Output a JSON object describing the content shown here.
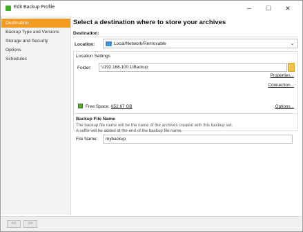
{
  "window": {
    "title": "Edit Backup Profile",
    "minimize": "─",
    "maximize": "☐",
    "close": "✕"
  },
  "sidebar": {
    "items": [
      {
        "label": "Destination",
        "active": true
      },
      {
        "label": "Backup Type and Versions",
        "active": false
      },
      {
        "label": "Storage and Security",
        "active": false
      },
      {
        "label": "Options",
        "active": false
      },
      {
        "label": "Schedules",
        "active": false
      }
    ]
  },
  "main": {
    "heading": "Select a destination where to store your archives",
    "destination_label": "Destination:",
    "location_label": "Location:",
    "location_value": "Local/Network/Removable",
    "location_settings_title": "Location Settings",
    "folder_label": "Folder:",
    "folder_value": "\\\\192.168.100.1\\Backup",
    "properties_link": "Properties...",
    "connection_link": "Connection...",
    "free_space_label": "Free Space:",
    "free_space_value": "652.67 GB",
    "options_link": "Options..."
  },
  "backup_file": {
    "title": "Backup File Name",
    "desc_line1": "The backup file name will be the name of the archives created with this backup set.",
    "desc_line2": "A suffix will be added at the end of the backup file name.",
    "file_name_label": "File Name:",
    "file_name_value": "mybackup"
  },
  "footer": {
    "back_label": "<<",
    "forward_label": ">>"
  }
}
